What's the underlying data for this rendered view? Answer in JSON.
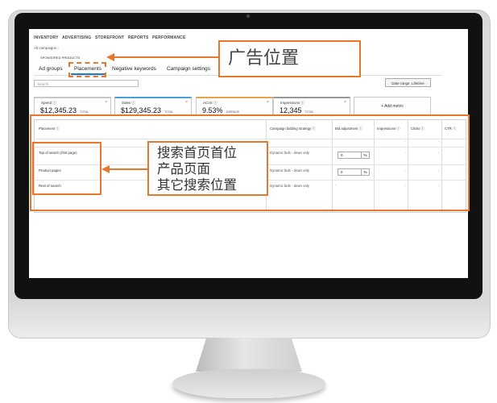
{
  "nav": {
    "items": [
      "INVENTORY",
      "ADVERTISING",
      "STOREFRONT",
      "REPORTS",
      "PERFORMANCE"
    ]
  },
  "breadcrumb": "All campaigns ›",
  "section_label": "SPONSORED PRODUCTS",
  "tabs": [
    "Ad groups",
    "Placements",
    "Negative keywords",
    "Campaign settings"
  ],
  "active_tab": "Placements",
  "search": {
    "placeholder": "Search"
  },
  "date_range": "Date range: Lifetime",
  "metrics": [
    {
      "label": "Spend ⓘ",
      "value": "$12,345.23",
      "suffix": "TOTAL"
    },
    {
      "label": "Sales ⓘ",
      "value": "$129,345.23",
      "suffix": "TOTAL"
    },
    {
      "label": "ACoS ⓘ",
      "value": "9.53%",
      "suffix": "AVERAGE"
    },
    {
      "label": "Impressions ⓘ",
      "value": "12,345",
      "suffix": "TOTAL"
    }
  ],
  "add_metric": "+ Add metric",
  "table": {
    "headers": [
      "Placement ⓘ",
      "Campaign bidding strategy ⓘ",
      "Bid adjustment ⓘ",
      "Impressions ⓘ",
      "Clicks ⓘ",
      "CTR ⓘ"
    ],
    "rows": [
      {
        "placement": "Top of search (first page)",
        "strategy": "Dynamic bids - down only",
        "bid": "0",
        "pct": "%",
        "impressions": "-",
        "clicks": "",
        "ctr": "-"
      },
      {
        "placement": "Product pages",
        "strategy": "Dynamic bids - down only",
        "bid": "0",
        "pct": "%",
        "impressions": "-",
        "clicks": "",
        "ctr": "-"
      },
      {
        "placement": "Rest of search",
        "strategy": "Dynamic bids - down only",
        "bid": "-",
        "pct": "",
        "impressions": "-",
        "clicks": "",
        "ctr": "-"
      }
    ],
    "subdash": "-"
  },
  "annotations": {
    "title_callout": "广告位置",
    "rows_callout": [
      "搜索首页首位",
      "产品页面",
      "其它搜索位置"
    ]
  },
  "colors": {
    "annotation": "#e8762b",
    "active_tab": "#1a7fc4"
  }
}
